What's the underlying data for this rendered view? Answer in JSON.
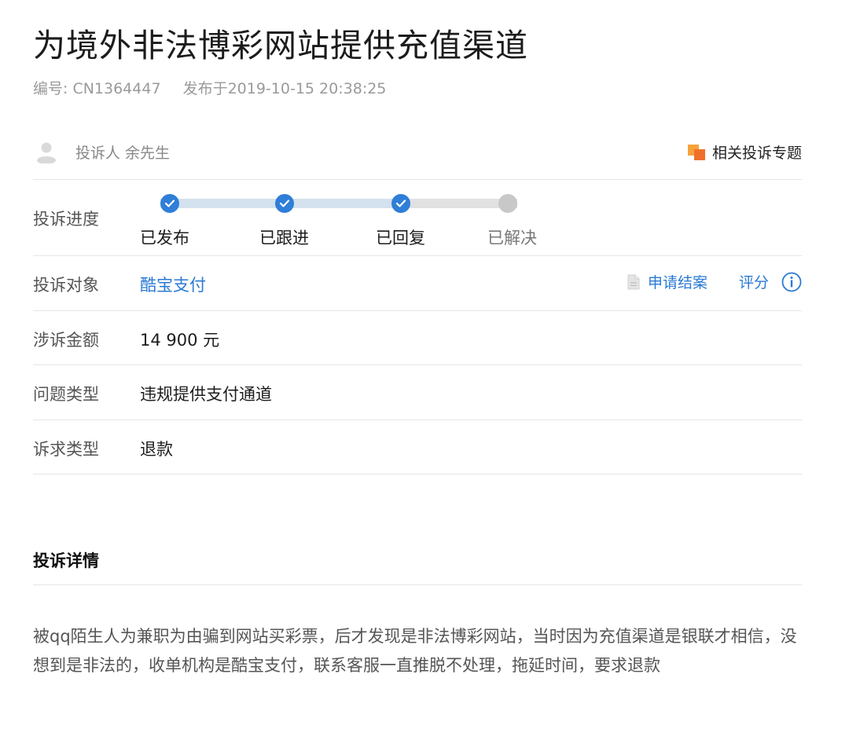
{
  "title": "为境外非法博彩网站提供充值渠道",
  "meta": {
    "id_label": "编号: CN1364447",
    "published": "发布于2019-10-15 20:38:25"
  },
  "complainant": {
    "text": "投诉人 余先生"
  },
  "related_topic": {
    "label": "相关投诉专题",
    "icon": "stacked-squares-icon",
    "icon_colors": [
      "#f7a23b",
      "#f0702b"
    ]
  },
  "progress": {
    "label": "投诉进度",
    "completed_steps": 3,
    "steps": [
      {
        "label": "已发布",
        "done": true
      },
      {
        "label": "已跟进",
        "done": true
      },
      {
        "label": "已回复",
        "done": true
      },
      {
        "label": "已解决",
        "done": false
      }
    ]
  },
  "target": {
    "label": "投诉对象",
    "value": "酷宝支付",
    "apply_close": "申请结案",
    "rate": "评分"
  },
  "amount": {
    "label": "涉诉金额",
    "value": "14 900 元"
  },
  "problem_type": {
    "label": "问题类型",
    "value": "违规提供支付通道"
  },
  "demand_type": {
    "label": "诉求类型",
    "value": "退款"
  },
  "details": {
    "heading": "投诉详情",
    "text": "被qq陌生人为兼职为由骗到网站买彩票，后才发现是非法博彩网站，当时因为充值渠道是银联才相信，没想到是非法的，收单机构是酷宝支付，联系客服一直推脱不处理，拖延时间，要求退款"
  },
  "colors": {
    "accent": "#2a7ad5",
    "step_done": "#2f7ed8",
    "step_todo": "#c8c8c8"
  }
}
